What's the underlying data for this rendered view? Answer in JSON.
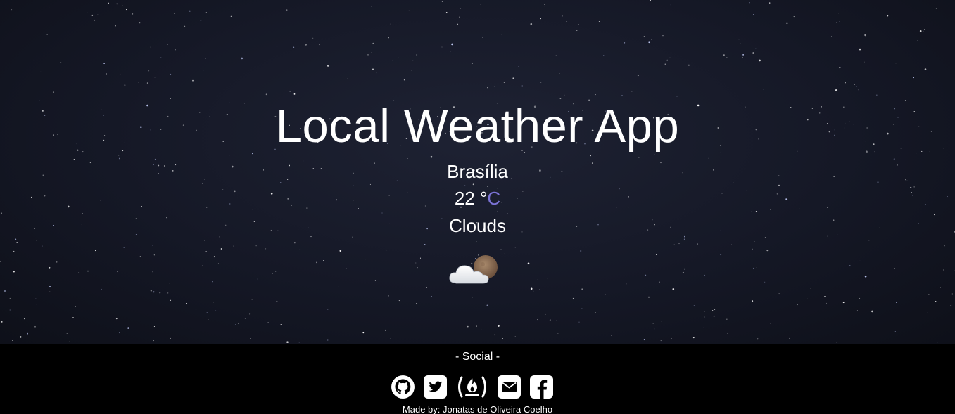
{
  "header": {
    "title": "Local Weather App"
  },
  "weather": {
    "city": "Brasília",
    "temperature": "22",
    "degree_symbol": "°",
    "unit": "C",
    "condition": "Clouds",
    "icon": "cloud-moon-icon"
  },
  "footer": {
    "social_title": "- Social -",
    "social_links": [
      {
        "icon": "github-icon"
      },
      {
        "icon": "twitter-icon"
      },
      {
        "icon": "freecodecamp-icon"
      },
      {
        "icon": "email-icon"
      },
      {
        "icon": "facebook-icon"
      }
    ],
    "credit": "Made by: Jonatas de Oliveira Coelho"
  },
  "colors": {
    "background": "#151826",
    "footer_background": "#000000",
    "text": "#ffffff",
    "unit_accent": "#7b73d6"
  }
}
